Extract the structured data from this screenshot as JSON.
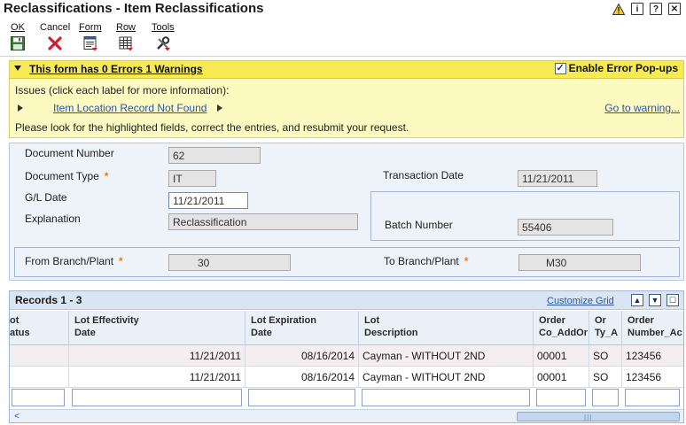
{
  "window": {
    "title": "Reclassifications - Item Reclassifications"
  },
  "toolbar": {
    "ok": {
      "label": "OK",
      "icon": "save-icon"
    },
    "cancel": {
      "label": "Cancel",
      "icon": "cancel-x-icon"
    },
    "form": {
      "label": "Form",
      "icon": "form-menu-icon"
    },
    "row": {
      "label": "Row",
      "icon": "row-menu-icon"
    },
    "tools": {
      "label": "Tools",
      "icon": "tools-icon"
    }
  },
  "warning_panel": {
    "title": "This form has 0 Errors 1 Warnings",
    "popups_label": "Enable Error Pop-ups",
    "popups_checked": true,
    "issues_label": "Issues (click each label for more information):",
    "issue_link": "Item Location Record Not Found",
    "goto_link": "Go to warning...",
    "message": "Please look for the highlighted fields, correct the entries, and resubmit your request."
  },
  "form": {
    "document_number": {
      "label": "Document Number",
      "value": "62"
    },
    "document_type": {
      "label": "Document Type",
      "value": "IT",
      "required_mark": "*"
    },
    "transaction_date": {
      "label": "Transaction Date",
      "value": "11/21/2011"
    },
    "gl_date": {
      "label": "G/L Date",
      "value": "11/21/2011"
    },
    "explanation": {
      "label": "Explanation",
      "value": "Reclassification"
    },
    "batch_number": {
      "label": "Batch Number",
      "value": "55406"
    },
    "from_branch": {
      "label": "From Branch/Plant",
      "value": "30",
      "required_mark": "*"
    },
    "to_branch": {
      "label": "To Branch/Plant",
      "value": "M30",
      "required_mark": "*"
    }
  },
  "grid": {
    "title": "Records 1 - 3",
    "customize_link": "Customize Grid",
    "columns": [
      "ot\natus",
      "Lot Effectivity\nDate",
      "Lot Expiration\nDate",
      "Lot\nDescription",
      "Order\nCo_AddOr",
      "Or\nTy_A",
      "Order\nNumber_Ac"
    ],
    "rows": [
      [
        "",
        "11/21/2011",
        "08/16/2014",
        "Cayman - WITHOUT 2ND",
        "00001",
        "SO",
        "123456"
      ],
      [
        "",
        "11/21/2011",
        "08/16/2014",
        "Cayman - WITHOUT 2ND",
        "00001",
        "SO",
        "123456"
      ]
    ]
  },
  "colors": {
    "warning_header": "#f7ea52",
    "warning_body": "#fcf9c1",
    "required": "#e87a1b",
    "link": "#2a55a8",
    "panel": "#eef3f9"
  }
}
